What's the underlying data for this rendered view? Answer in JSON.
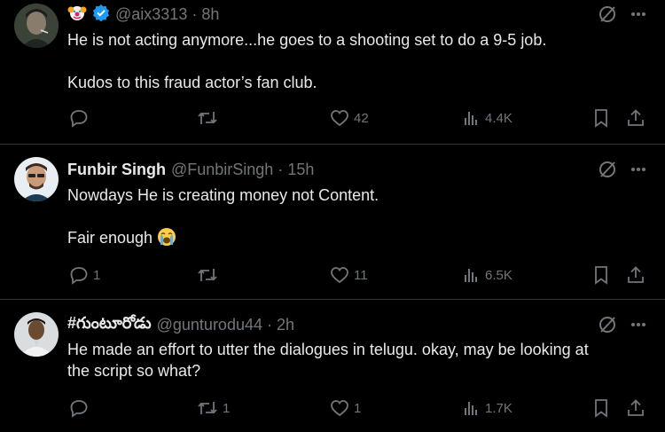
{
  "tweets": [
    {
      "display_name": "",
      "handle": "@aix3313",
      "time": "8h",
      "lines": [
        "He is not acting anymore...he goes to a shooting set to do a 9-5 job.",
        "Kudos to this fraud actor’s fan club."
      ],
      "reply_count": "",
      "retweet_count": "",
      "like_count": "42",
      "view_count": "4.4K"
    },
    {
      "display_name": "Funbir Singh",
      "handle": "@FunbirSingh",
      "time": "15h",
      "lines": [
        "Nowdays He is creating money not Content.",
        "Fair enough"
      ],
      "reply_count": "1",
      "retweet_count": "",
      "like_count": "11",
      "view_count": "6.5K"
    },
    {
      "display_name": "#గుంటూరోడు",
      "handle": "@gunturodu44",
      "time": "2h",
      "lines": [
        "He made an effort to utter the dialogues in telugu. okay, may be looking at",
        "the script so what?"
      ],
      "reply_count": "",
      "retweet_count": "1",
      "like_count": "1",
      "view_count": "1.7K"
    }
  ],
  "separator": "·",
  "icons": {
    "reply": "reply-icon",
    "retweet": "retweet-icon",
    "like": "heart-icon",
    "views": "views-icon",
    "bookmark": "bookmark-icon",
    "share": "share-icon",
    "grok": "grok-icon",
    "more": "more-icon",
    "verified": "verified-badge-icon",
    "clown": "clown-emoji-icon",
    "crying": "crying-emoji-icon"
  },
  "colors": {
    "background": "#000000",
    "text": "#e7e9ea",
    "muted": "#71767b",
    "verified": "#1d9bf0",
    "divider": "#2f3336"
  }
}
